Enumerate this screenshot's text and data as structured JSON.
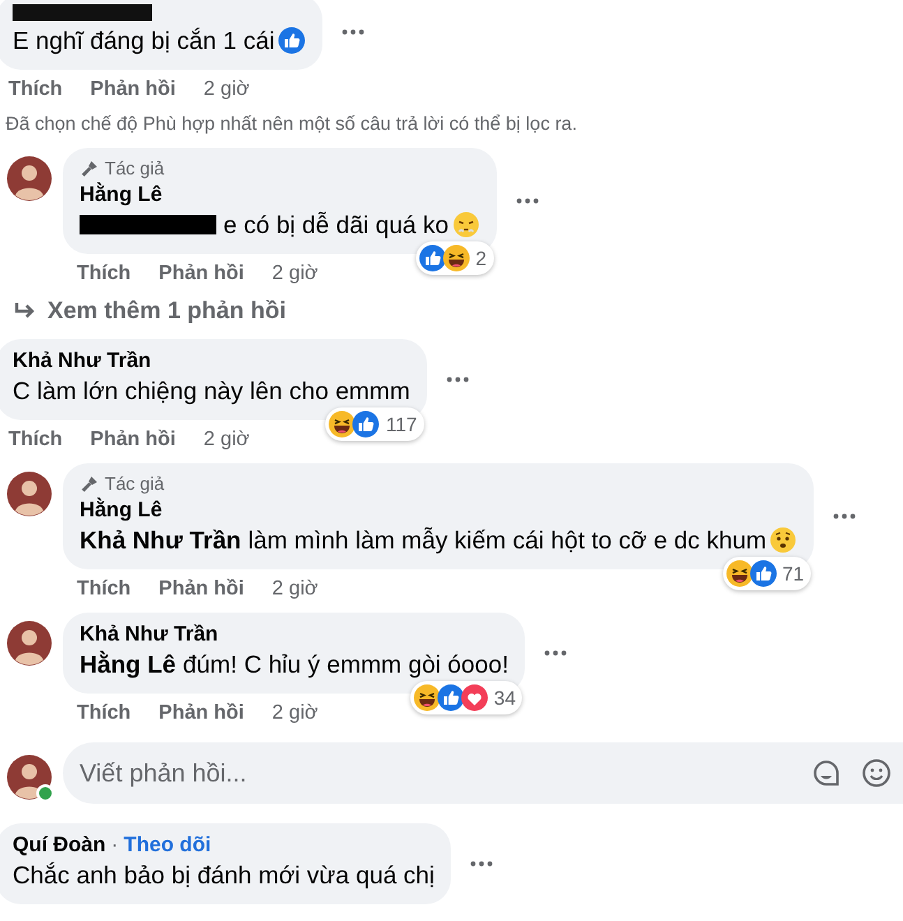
{
  "comments": [
    {
      "kind": "comment",
      "avatar": false,
      "name_redacted": true,
      "text": "E nghĩ đáng bị cắn 1 cái",
      "text_emoji": {
        "kind": "like"
      },
      "actions": [
        "Thích",
        "Phản hồi",
        "2 giờ"
      ]
    },
    {
      "kind": "notice",
      "text": "Đã chọn chế độ Phù hợp nhất nên một số câu trả lời có thể bị lọc ra."
    },
    {
      "kind": "comment",
      "avatar": true,
      "badge": "Tác giả",
      "name": "Hằng Lê",
      "mention_redacted": true,
      "text": "e có bị dễ dãi quá ko",
      "text_emoji": {
        "kind": "pout"
      },
      "reactions": [
        {
          "kind": "like"
        },
        {
          "kind": "haha"
        }
      ],
      "reaction_count": "2",
      "actions": [
        "Thích",
        "Phản hồi",
        "2 giờ"
      ]
    },
    {
      "kind": "more",
      "text": "Xem thêm 1 phản hồi"
    },
    {
      "kind": "comment",
      "avatar": false,
      "name": "Khả Như Trần",
      "text": "C làm lớn chiệng này lên cho emmm",
      "reactions": [
        {
          "kind": "haha"
        },
        {
          "kind": "like"
        }
      ],
      "reaction_count": "117",
      "actions": [
        "Thích",
        "Phản hồi",
        "2 giờ"
      ]
    },
    {
      "kind": "comment",
      "avatar": true,
      "badge": "Tác giả",
      "name": "Hằng Lê",
      "mention": "Khả Như Trần",
      "text": "làm mình làm mẫy kiếm cái hột to cỡ e dc khum",
      "text_emoji": {
        "kind": "worried"
      },
      "reactions": [
        {
          "kind": "haha"
        },
        {
          "kind": "like"
        }
      ],
      "reaction_count": "71",
      "actions": [
        "Thích",
        "Phản hồi",
        "2 giờ"
      ]
    },
    {
      "kind": "comment",
      "avatar": true,
      "name": "Khả Như Trần",
      "mention": "Hằng Lê",
      "text": "đúm! C hỉu ý emmm gòi óooo!",
      "reactions": [
        {
          "kind": "haha"
        },
        {
          "kind": "like"
        },
        {
          "kind": "love"
        }
      ],
      "reaction_count": "34",
      "actions": [
        "Thích",
        "Phản hồi",
        "2 giờ"
      ]
    },
    {
      "kind": "reply_box",
      "placeholder": "Viết phản hồi...",
      "online": true
    },
    {
      "kind": "comment",
      "avatar": false,
      "name": "Quí Đoàn",
      "separator": "·",
      "follow": "Theo dõi",
      "text": "Chắc anh bảo bị đánh mới vừa quá chị"
    }
  ]
}
